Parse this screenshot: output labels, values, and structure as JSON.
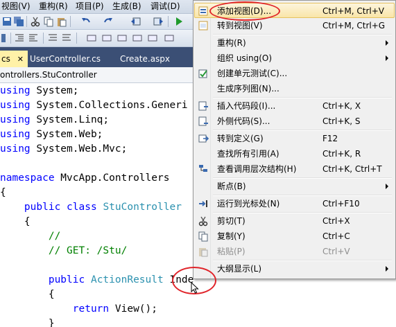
{
  "menubar": {
    "items": [
      "视图(V)",
      "重构(R)",
      "项目(P)",
      "生成(B)",
      "调试(D)"
    ]
  },
  "tabs": {
    "active_fragment": "cs",
    "active_close": "✕",
    "items": [
      "UserController.cs",
      "Create.aspx"
    ]
  },
  "navbar": {
    "text": "ontrollers.StuController"
  },
  "code": {
    "lines": [
      [
        {
          "t": "using",
          "c": "kw"
        },
        {
          "t": " System;"
        }
      ],
      [
        {
          "t": "using",
          "c": "kw"
        },
        {
          "t": " System.Collections.Generi"
        }
      ],
      [
        {
          "t": "using",
          "c": "kw"
        },
        {
          "t": " System.Linq;"
        }
      ],
      [
        {
          "t": "using",
          "c": "kw"
        },
        {
          "t": " System.Web;"
        }
      ],
      [
        {
          "t": "using",
          "c": "kw"
        },
        {
          "t": " System.Web.Mvc;"
        }
      ],
      [],
      [
        {
          "t": "namespace",
          "c": "kw"
        },
        {
          "t": " MvcApp.Controllers"
        }
      ],
      [
        {
          "t": "{"
        }
      ],
      [
        {
          "t": "    "
        },
        {
          "t": "public",
          "c": "kw"
        },
        {
          "t": " "
        },
        {
          "t": "class",
          "c": "kw"
        },
        {
          "t": " "
        },
        {
          "t": "StuController",
          "c": "ty"
        }
      ],
      [
        {
          "t": "    {"
        }
      ],
      [
        {
          "t": "        "
        },
        {
          "t": "//",
          "c": "cm"
        }
      ],
      [
        {
          "t": "        "
        },
        {
          "t": "// GET: /Stu/",
          "c": "cm"
        }
      ],
      [],
      [
        {
          "t": "        "
        },
        {
          "t": "public",
          "c": "kw"
        },
        {
          "t": " "
        },
        {
          "t": "ActionResult",
          "c": "ty"
        },
        {
          "t": " Index()"
        }
      ],
      [
        {
          "t": "        {"
        }
      ],
      [
        {
          "t": "            "
        },
        {
          "t": "return",
          "c": "kw"
        },
        {
          "t": " View();"
        }
      ],
      [
        {
          "t": "        }"
        }
      ]
    ]
  },
  "context_menu": {
    "items": [
      {
        "label": "添加视图(D)...",
        "shortcut": "Ctrl+M, Ctrl+V",
        "icon": "add-view-icon",
        "highlight": true
      },
      {
        "label": "转到视图(V)",
        "shortcut": "Ctrl+M, Ctrl+G",
        "icon": "go-to-view-icon"
      },
      {
        "sep": true
      },
      {
        "label": "重构(R)",
        "submenu": true
      },
      {
        "label": "组织 using(O)",
        "submenu": true
      },
      {
        "label": "创建单元测试(C)...",
        "icon": "unit-test-icon"
      },
      {
        "label": "生成序列图(N)..."
      },
      {
        "sep": true
      },
      {
        "label": "插入代码段(I)...",
        "shortcut": "Ctrl+K, X",
        "icon": "insert-snippet-icon"
      },
      {
        "label": "外侧代码(S)...",
        "shortcut": "Ctrl+K, S",
        "icon": "surround-with-icon"
      },
      {
        "sep": true
      },
      {
        "label": "转到定义(G)",
        "shortcut": "F12",
        "icon": "go-to-definition-icon"
      },
      {
        "label": "查找所有引用(A)",
        "shortcut": "Ctrl+K, R"
      },
      {
        "label": "查看调用层次结构(H)",
        "shortcut": "Ctrl+K, Ctrl+T",
        "icon": "call-hierarchy-icon"
      },
      {
        "sep": true
      },
      {
        "label": "断点(B)",
        "submenu": true
      },
      {
        "sep": true
      },
      {
        "label": "运行到光标处(N)",
        "shortcut": "Ctrl+F10",
        "icon": "run-to-cursor-icon"
      },
      {
        "sep": true
      },
      {
        "label": "剪切(T)",
        "shortcut": "Ctrl+X",
        "icon": "cut-icon"
      },
      {
        "label": "复制(Y)",
        "shortcut": "Ctrl+C",
        "icon": "copy-icon"
      },
      {
        "label": "粘贴(P)",
        "shortcut": "Ctrl+V",
        "icon": "paste-icon",
        "disabled": true
      },
      {
        "sep": true
      },
      {
        "label": "大纲显示(L)",
        "submenu": true
      }
    ]
  }
}
